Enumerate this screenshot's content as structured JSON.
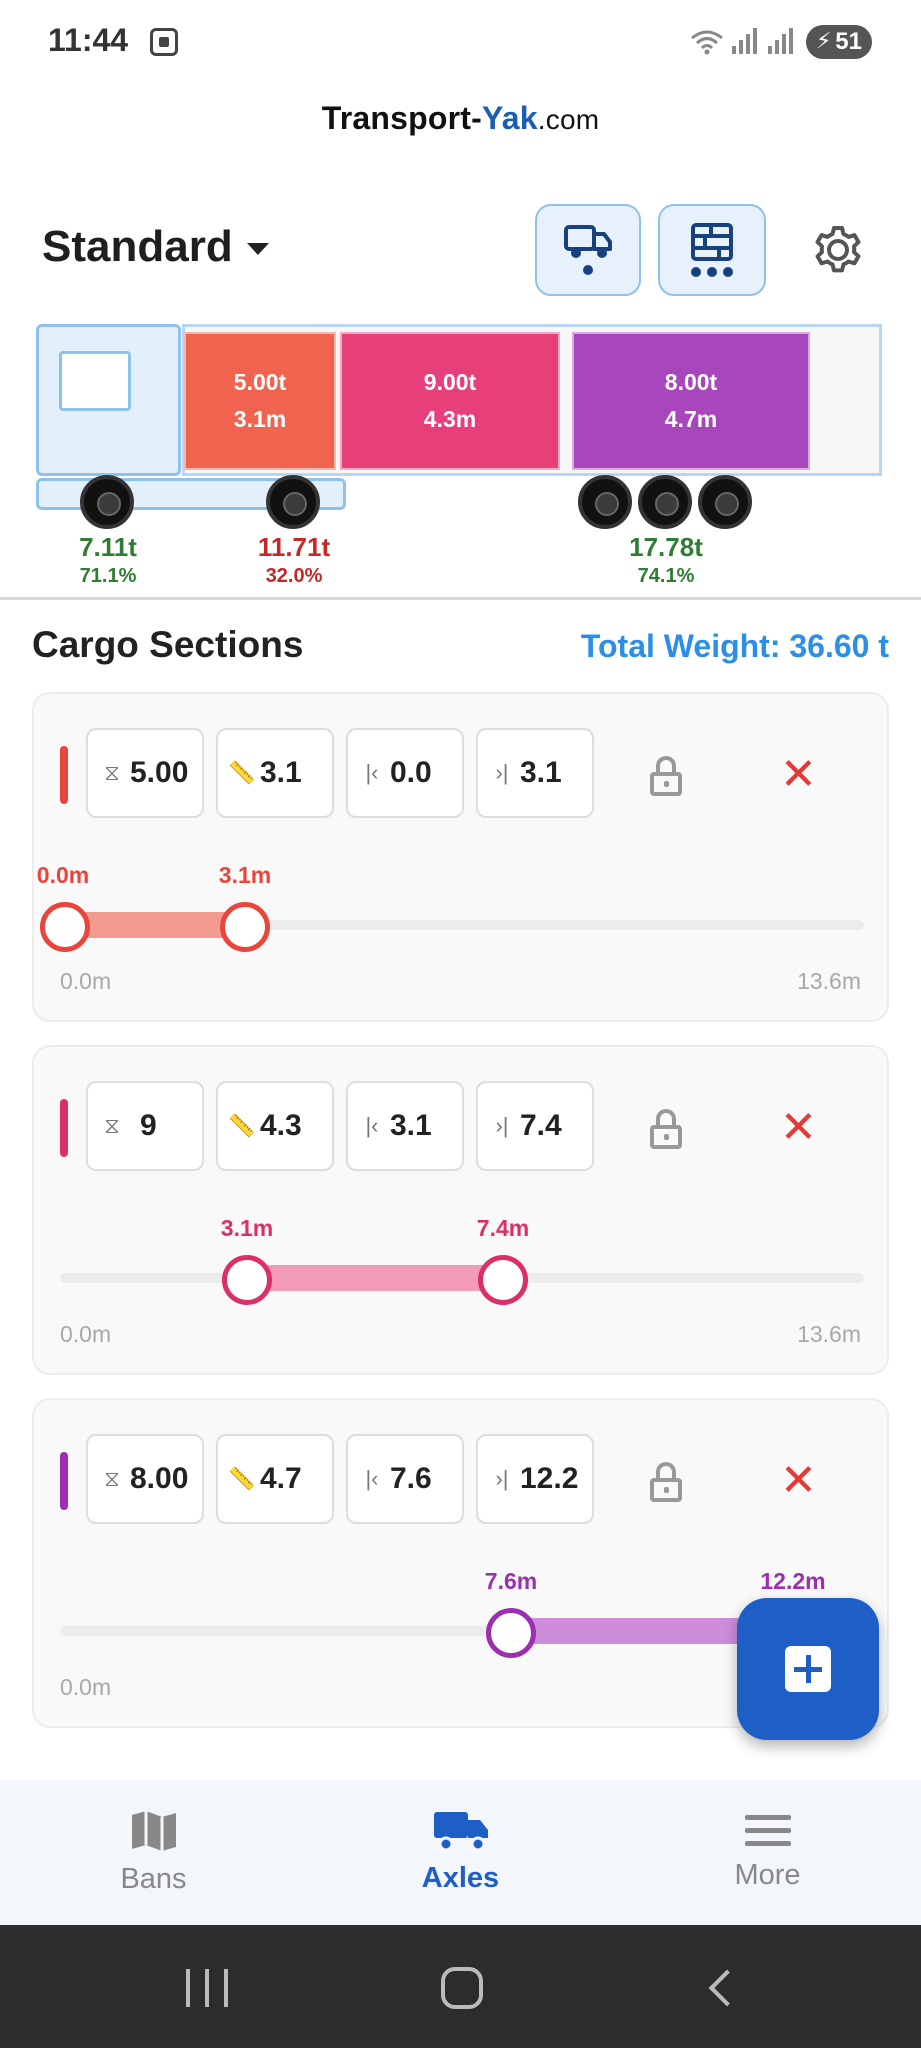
{
  "status_bar": {
    "time": "11:44",
    "battery": "51"
  },
  "logo": {
    "part1": "Transport-",
    "part2": "Yak",
    "part3": ".com"
  },
  "header": {
    "profile_name": "Standard"
  },
  "truck": {
    "cargo": [
      {
        "weight": "5.00t",
        "length": "3.1m",
        "color": "#f0634f"
      },
      {
        "weight": "9.00t",
        "length": "4.3m",
        "color": "#e63f7a"
      },
      {
        "weight": "8.00t",
        "length": "4.7m",
        "color": "#a846bc"
      }
    ],
    "axles": [
      {
        "weight": "7.11t",
        "percent": "71.1%",
        "color": "#2e7d32"
      },
      {
        "weight": "11.71t",
        "percent": "32.0%",
        "color": "#c62828"
      },
      {
        "weight": "17.78t",
        "percent": "74.1%",
        "color": "#2e7d32"
      }
    ]
  },
  "sections": {
    "title": "Cargo Sections",
    "total_weight": "Total Weight: 36.60 t",
    "items": [
      {
        "color": "#e8453c",
        "weight": "5.00",
        "length": "3.1",
        "start": "0.0",
        "end": "3.1",
        "start_label": "0.0m",
        "end_label": "3.1m",
        "range_min": "0.0m",
        "range_max": "13.6m",
        "start_fraction": 0.0,
        "end_fraction": 0.228
      },
      {
        "color": "#dc2f6a",
        "weight": "9",
        "length": "4.3",
        "start": "3.1",
        "end": "7.4",
        "start_label": "3.1m",
        "end_label": "7.4m",
        "range_min": "0.0m",
        "range_max": "13.6m",
        "start_fraction": 0.228,
        "end_fraction": 0.544
      },
      {
        "color": "#9c2fb0",
        "weight": "8.00",
        "length": "4.7",
        "start": "7.6",
        "end": "12.2",
        "start_label": "7.6m",
        "end_label": "12.2m",
        "range_min": "0.0m",
        "range_max": "",
        "start_fraction": 0.559,
        "end_fraction": 0.897
      }
    ]
  },
  "bottom_nav": {
    "items": [
      {
        "label": "Bans",
        "icon": "map-icon"
      },
      {
        "label": "Axles",
        "icon": "truck-icon",
        "active": true
      },
      {
        "label": "More",
        "icon": "menu-icon"
      }
    ]
  }
}
